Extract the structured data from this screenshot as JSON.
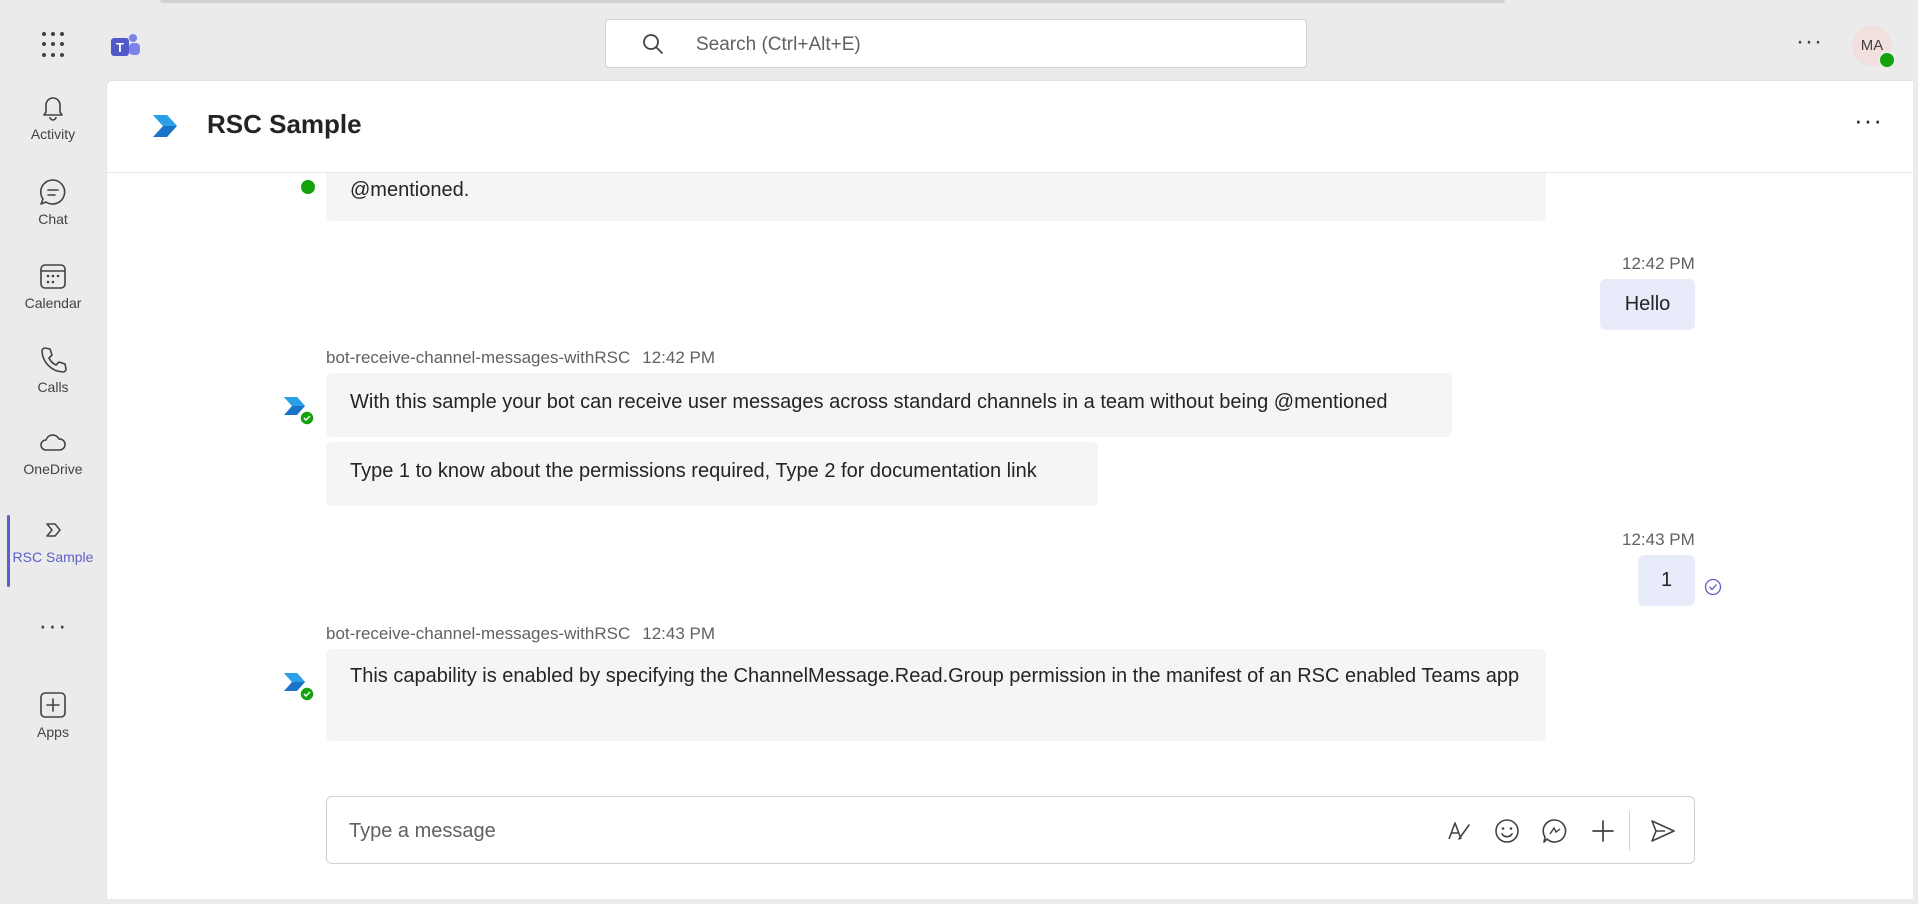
{
  "search": {
    "placeholder": "Search (Ctrl+Alt+E)"
  },
  "user": {
    "initials": "MA"
  },
  "rail": {
    "items": [
      {
        "label": "Activity",
        "icon": "bell-icon"
      },
      {
        "label": "Chat",
        "icon": "chat-icon"
      },
      {
        "label": "Calendar",
        "icon": "calendar-icon"
      },
      {
        "label": "Calls",
        "icon": "phone-icon"
      },
      {
        "label": "OneDrive",
        "icon": "cloud-icon"
      },
      {
        "label": "RSC Sample",
        "icon": "rsc-app-icon",
        "active": true
      },
      {
        "label": "Apps",
        "icon": "add-apps-icon"
      }
    ]
  },
  "header": {
    "title": "RSC Sample"
  },
  "messages": {
    "partial_text": "@mentioned.",
    "me1": {
      "time": "12:42 PM",
      "text": "Hello"
    },
    "bot1": {
      "sender": "bot-receive-channel-messages-withRSC",
      "time": "12:42 PM",
      "text1": "With this sample your bot can receive user messages across standard channels in a team without being @mentioned",
      "text2": "Type 1 to know about the permissions required, Type 2 for documentation link"
    },
    "me2": {
      "time": "12:43 PM",
      "text": "1"
    },
    "bot2": {
      "sender": "bot-receive-channel-messages-withRSC",
      "time": "12:43 PM",
      "text": "This capability is enabled by specifying the ChannelMessage.Read.Group permission in the manifest of an RSC enabled Teams app"
    }
  },
  "compose": {
    "placeholder": "Type a message"
  },
  "colors": {
    "accent": "#5b5fc7",
    "presence": "#13a10e",
    "my_bubble": "#e8ebfa",
    "bot_bubble": "#f5f5f5"
  }
}
